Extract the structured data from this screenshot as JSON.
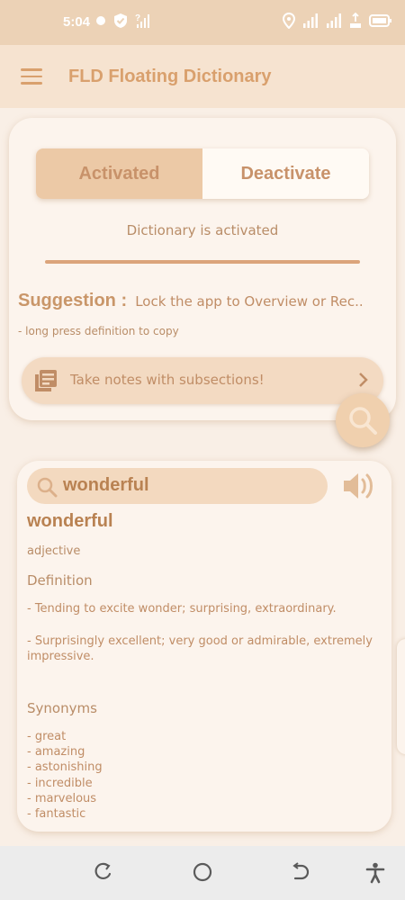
{
  "status_bar": {
    "time": "5:04",
    "icons": [
      "dot-icon",
      "shield-check-icon",
      "signal-question-icon",
      "location-icon",
      "signal-icon",
      "data-rate-icon",
      "battery-icon"
    ]
  },
  "app_bar": {
    "title": "FLD Floating Dictionary"
  },
  "activation_card": {
    "toggle": {
      "activated_label": "Activated",
      "deactivate_label": "Deactivate",
      "selected": "Activated"
    },
    "status": "Dictionary is activated",
    "suggestion_label": "Suggestion :",
    "suggestion_text": "Lock the app to Overview or Rec..",
    "hint": "- long press definition to copy",
    "notes_button_label": "Take notes with subsections!"
  },
  "dictionary_card": {
    "search_value": "wonderful",
    "word": "wonderful",
    "part_of_speech": "adjective",
    "definition_heading": "Definition",
    "definitions": [
      "- Tending to excite wonder; surprising, extraordinary.",
      "- Surprisingly excellent; very good or admirable, extremely impressive."
    ],
    "synonyms_heading": "Synonyms",
    "synonyms": [
      "- great",
      "- amazing",
      "- astonishing",
      "- incredible",
      "- marvelous",
      "- fantastic"
    ]
  },
  "colors": {
    "accent": "#d9a06d",
    "status_bar": "#ecd2b6",
    "app_bar": "#f6e3d0",
    "background": "#f9efe6"
  }
}
